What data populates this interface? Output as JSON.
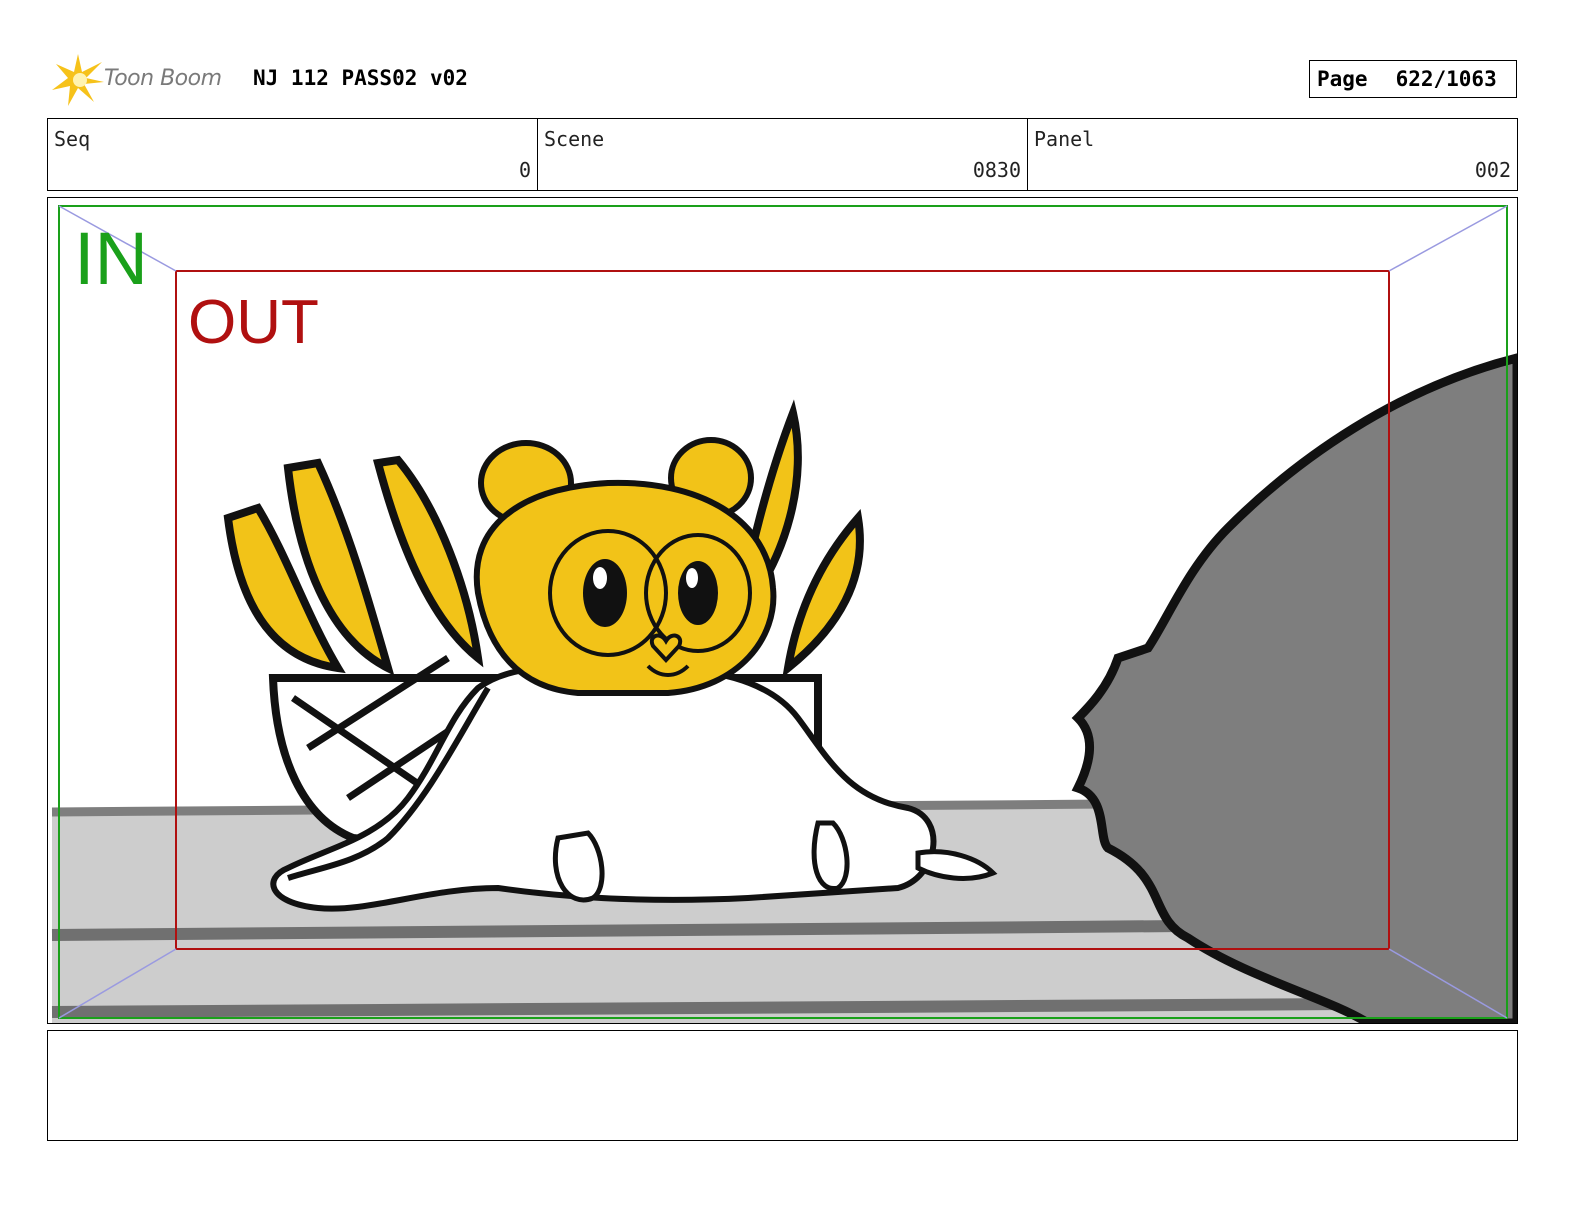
{
  "header": {
    "logo_text": "Toon Boom",
    "title": "NJ 112 PASS02 v02",
    "page_label": "Page",
    "page_value": "622/1063"
  },
  "info": {
    "seq_label": "Seq",
    "seq_value": "0",
    "scene_label": "Scene",
    "scene_value": "0830",
    "panel_label": "Panel",
    "panel_value": "002"
  },
  "panel": {
    "in_label": "IN",
    "out_label": "OUT",
    "colors": {
      "in_frame": "#1aa01a",
      "out_frame": "#b01010",
      "character_yellow": "#f2c318",
      "floor_gray": "#cdcdcd",
      "shadow_gray": "#7e7e7e"
    }
  },
  "notes": {
    "text": ""
  }
}
